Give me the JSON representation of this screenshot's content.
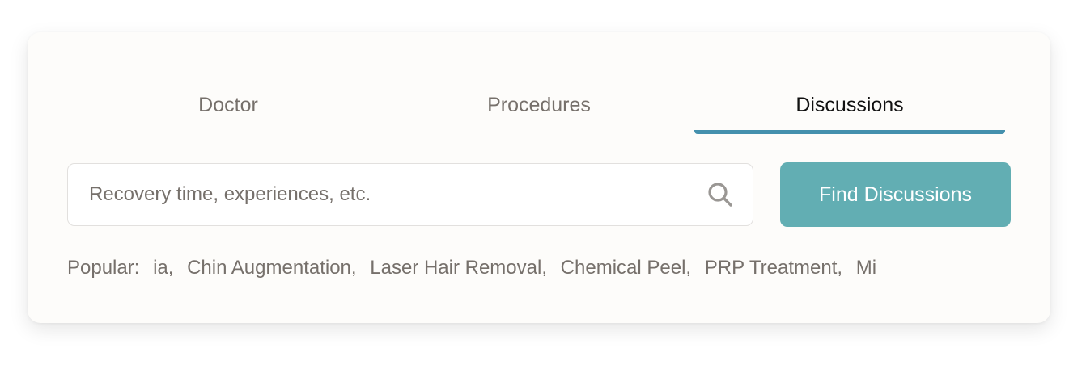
{
  "tabs": [
    {
      "label": "Doctor",
      "active": false
    },
    {
      "label": "Procedures",
      "active": false
    },
    {
      "label": "Discussions",
      "active": true
    }
  ],
  "search": {
    "placeholder": "Recovery time, experiences, etc.",
    "value": "",
    "icon": "search-icon"
  },
  "find_button": {
    "label": "Find Discussions"
  },
  "popular": {
    "label": "Popular:",
    "items": [
      "ia,",
      "Chin Augmentation,",
      "Laser Hair Removal,",
      "Chemical Peel,",
      "PRP Treatment,",
      "Mi"
    ]
  },
  "colors": {
    "accent": "#4490ad",
    "button": "#62aeb3"
  }
}
